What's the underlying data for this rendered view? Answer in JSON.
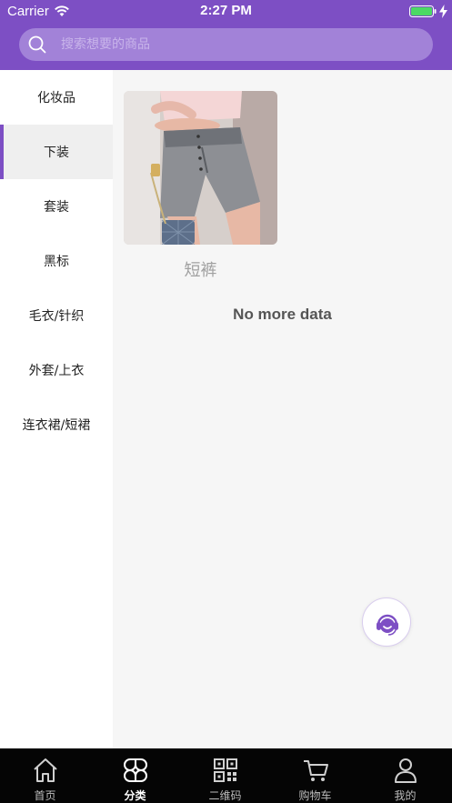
{
  "status_bar": {
    "carrier": "Carrier",
    "time": "2:27 PM"
  },
  "search": {
    "placeholder": "搜索想要的商品",
    "icon": "search-icon"
  },
  "sidebar": {
    "items": [
      {
        "label": "化妆品",
        "active": false
      },
      {
        "label": "下装",
        "active": true
      },
      {
        "label": "套装",
        "active": false
      },
      {
        "label": "黑标",
        "active": false
      },
      {
        "label": "毛衣/针织",
        "active": false
      },
      {
        "label": "外套/上衣",
        "active": false
      },
      {
        "label": "连衣裙/短裙",
        "active": false
      }
    ]
  },
  "content": {
    "products": [
      {
        "name": "短裤"
      }
    ],
    "no_more_text": "No more data"
  },
  "support": {
    "icon": "headset-icon"
  },
  "tabbar": {
    "items": [
      {
        "label": "首页",
        "icon": "home-icon",
        "active": false
      },
      {
        "label": "分类",
        "icon": "category-icon",
        "active": true
      },
      {
        "label": "二维码",
        "icon": "qrcode-icon",
        "active": false
      },
      {
        "label": "购物车",
        "icon": "cart-icon",
        "active": false
      },
      {
        "label": "我的",
        "icon": "profile-icon",
        "active": false
      }
    ]
  },
  "colors": {
    "brand": "#7d4fc4",
    "search_bg": "#a282d8",
    "tabbar_bg": "#050505",
    "battery": "#4cd964"
  }
}
